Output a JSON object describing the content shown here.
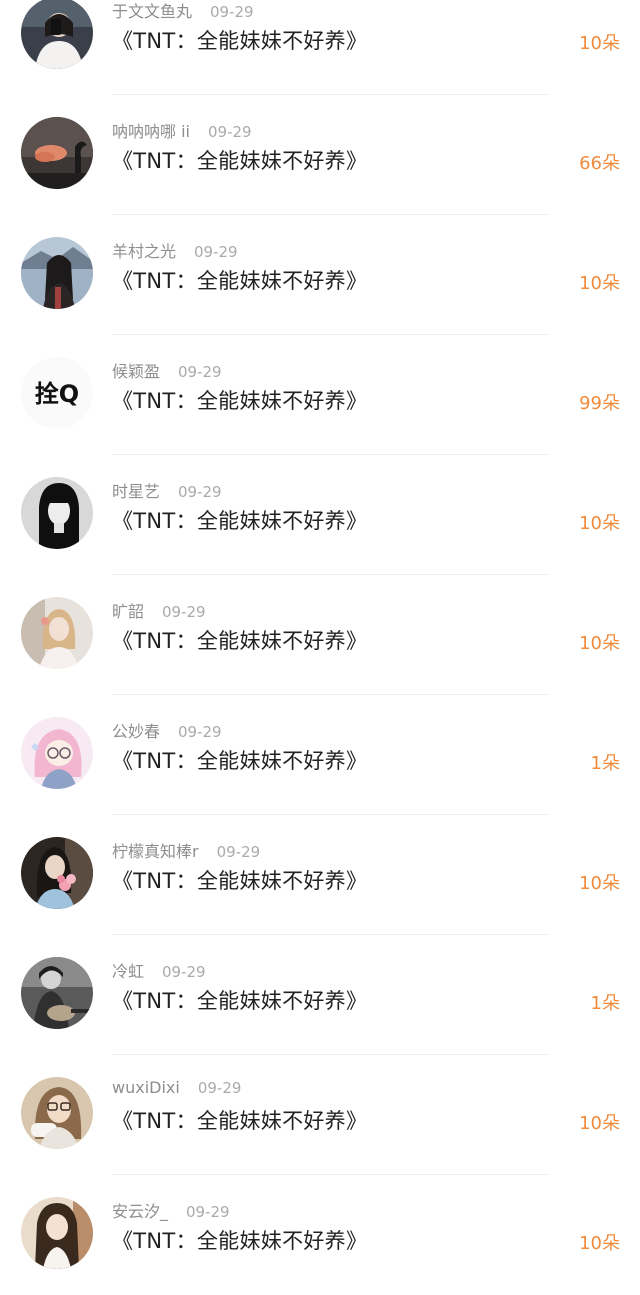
{
  "items": [
    {
      "name": "于文文鱼丸",
      "date": "09-29",
      "title": "《TNT：全能妹妹不好养》",
      "count": "10朵",
      "avatar_icon": "girl-phone-avatar-icon"
    },
    {
      "name": "呐呐呐哪 ii",
      "date": "09-29",
      "title": "《TNT：全能妹妹不好养》",
      "count": "66朵",
      "avatar_icon": "sunset-cloud-avatar-icon"
    },
    {
      "name": "羊村之光",
      "date": "09-29",
      "title": "《TNT：全能妹妹不好养》",
      "count": "10朵",
      "avatar_icon": "lake-girl-avatar-icon"
    },
    {
      "name": "候颖盈",
      "date": "09-29",
      "title": "《TNT：全能妹妹不好养》",
      "count": "99朵",
      "avatar_icon": "text-avatar-icon",
      "avatar_text": "拴Q"
    },
    {
      "name": "时星艺",
      "date": "09-29",
      "title": "《TNT：全能妹妹不好养》",
      "count": "10朵",
      "avatar_icon": "bw-portrait-avatar-icon"
    },
    {
      "name": "旷韶",
      "date": "09-29",
      "title": "《TNT：全能妹妹不好养》",
      "count": "10朵",
      "avatar_icon": "blonde-girl-avatar-icon"
    },
    {
      "name": "公妙春",
      "date": "09-29",
      "title": "《TNT：全能妹妹不好养》",
      "count": "1朵",
      "avatar_icon": "anime-girl-avatar-icon"
    },
    {
      "name": "柠檬真知棒r",
      "date": "09-29",
      "title": "《TNT：全能妹妹不好养》",
      "count": "10朵",
      "avatar_icon": "flower-girl-avatar-icon"
    },
    {
      "name": "冷虹",
      "date": "09-29",
      "title": "《TNT：全能妹妹不好养》",
      "count": "1朵",
      "avatar_icon": "guitar-boy-avatar-icon"
    },
    {
      "name": "wuxiDixi",
      "date": "09-29",
      "title": "《TNT：全能妹妹不好养》",
      "count": "10朵",
      "avatar_icon": "glasses-girl-avatar-icon"
    },
    {
      "name": "安云汐_",
      "date": "09-29",
      "title": "《TNT：全能妹妹不好养》",
      "count": "10朵",
      "avatar_icon": "longhair-girl-avatar-icon"
    }
  ],
  "colors": {
    "count": "#f08a3c",
    "title": "#222222",
    "name": "#8e8e8e",
    "divider": "#f0f0f0"
  }
}
